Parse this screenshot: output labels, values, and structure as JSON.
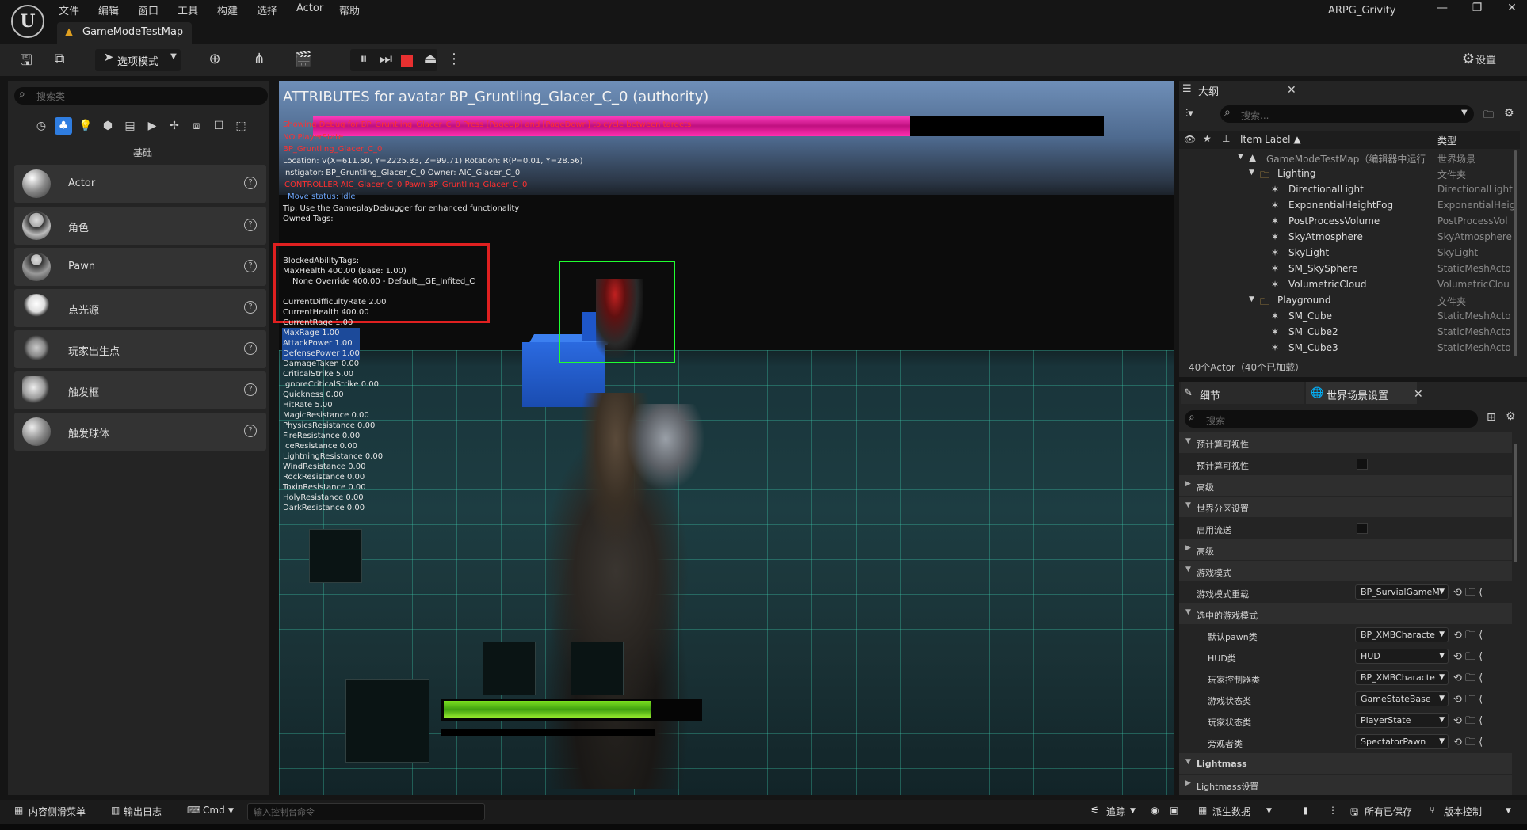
{
  "window": {
    "title": "ARPG_Grivity",
    "minimize": "—",
    "restore": "❐",
    "close": "✕"
  },
  "menu": [
    "文件",
    "编辑",
    "窗口",
    "工具",
    "构建",
    "选择",
    "Actor",
    "帮助"
  ],
  "tab": {
    "label": "GameModeTestMap"
  },
  "toolbar": {
    "mode_label": "选项模式",
    "settings_label": "设置"
  },
  "place_actors": {
    "search_placeholder": "搜索类",
    "category_label": "基础",
    "items": [
      {
        "label": "Actor"
      },
      {
        "label": "角色"
      },
      {
        "label": "Pawn"
      },
      {
        "label": "点光源"
      },
      {
        "label": "玩家出生点"
      },
      {
        "label": "触发框"
      },
      {
        "label": "触发球体"
      }
    ]
  },
  "viewport": {
    "debug_title": "ATTRIBUTES for avatar BP_Gruntling_Glacer_C_0 (authority)",
    "debug_header": "Showing Debug for BP_Gruntling_Glacer_C_0  Press [PageUp] and [PageDown] to cycle between targets",
    "red_lines": [
      "NO PlayerState",
      "BP_Gruntling_Glacer_C_0"
    ],
    "location_line": "Location: V(X=611.60, Y=2225.83, Z=99.71) Rotation: R(P=0.01, Y=28.56)",
    "instigator_line": "Instigator: BP_Gruntling_Glacer_C_0 Owner: AIC_Glacer_C_0",
    "controller_line": "CONTROLLER AIC_Glacer_C_0 Pawn BP_Gruntling_Glacer_C_0",
    "move_status": "Move status: Idle",
    "tip": "Tip: Use the GameplayDebugger for enhanced functionality",
    "owned_tags": "Owned Tags:",
    "blocked": "BlockedAbilityTags:",
    "max_health": "MaxHealth 400.00  (Base: 1.00)",
    "override": "None Override 400.00 - Default__GE_Infited_C",
    "attributes": [
      "CurrentDifficultyRate 2.00",
      "CurrentHealth 400.00",
      "CurrentRage 1.00",
      "MaxRage 1.00",
      "AttackPower 1.00",
      "DefensePower 1.00",
      "DamageTaken 0.00",
      "CriticalStrike 5.00",
      "IgnoreCriticalStrike 0.00",
      "Quickness 0.00",
      "HitRate 5.00",
      "MagicResistance 0.00",
      "PhysicsResistance 0.00",
      "FireResistance 0.00",
      "IceResistance 0.00",
      "LightningResistance 0.00",
      "WindResistance 0.00",
      "RockResistance 0.00",
      "ToxinResistance 0.00",
      "HolyResistance 0.00",
      "DarkResistance 0.00"
    ],
    "debug_bar_fraction": 0.755,
    "health_bar_fraction": 0.8
  },
  "outliner": {
    "title": "大纲",
    "search_placeholder": "搜索...",
    "col_label": "Item Label ▲",
    "col_type": "类型",
    "rows": [
      {
        "label": "GameModeTestMap（编辑器中运行",
        "type": "世界场景",
        "indent": 0
      },
      {
        "label": "Lighting",
        "type": "文件夹",
        "indent": 1
      },
      {
        "label": "DirectionalLight",
        "type": "DirectionalLight",
        "indent": 2
      },
      {
        "label": "ExponentialHeightFog",
        "type": "ExponentialHeig",
        "indent": 2
      },
      {
        "label": "PostProcessVolume",
        "type": "PostProcessVol",
        "indent": 2
      },
      {
        "label": "SkyAtmosphere",
        "type": "SkyAtmosphere",
        "indent": 2
      },
      {
        "label": "SkyLight",
        "type": "SkyLight",
        "indent": 2
      },
      {
        "label": "SM_SkySphere",
        "type": "StaticMeshActo",
        "indent": 2
      },
      {
        "label": "VolumetricCloud",
        "type": "VolumetricClou",
        "indent": 2
      },
      {
        "label": "Playground",
        "type": "文件夹",
        "indent": 1
      },
      {
        "label": "SM_Cube",
        "type": "StaticMeshActo",
        "indent": 2
      },
      {
        "label": "SM_Cube2",
        "type": "StaticMeshActo",
        "indent": 2
      },
      {
        "label": "SM_Cube3",
        "type": "StaticMeshActo",
        "indent": 2
      }
    ],
    "count": "40个Actor（40个已加载）"
  },
  "details": {
    "tab_details": "细节",
    "tab_world": "世界场景设置",
    "search_placeholder": "搜索",
    "rows": [
      {
        "kind": "section",
        "label": "预计算可视性",
        "open": true
      },
      {
        "kind": "check",
        "label": "预计算可视性"
      },
      {
        "kind": "section",
        "label": "高级",
        "open": false
      },
      {
        "kind": "section",
        "label": "世界分区设置",
        "open": true
      },
      {
        "kind": "check",
        "label": "启用流送"
      },
      {
        "kind": "section",
        "label": "高级",
        "open": false
      },
      {
        "kind": "section",
        "label": "游戏模式",
        "open": true
      },
      {
        "kind": "value",
        "label": "游戏模式重载",
        "value": "BP_SurvialGameM"
      },
      {
        "kind": "section",
        "label": "选中的游戏模式",
        "open": true
      },
      {
        "kind": "value",
        "label": "默认pawn类",
        "value": "BP_XMBCharacte"
      },
      {
        "kind": "value",
        "label": "HUD类",
        "value": "HUD"
      },
      {
        "kind": "value",
        "label": "玩家控制器类",
        "value": "BP_XMBCharacte"
      },
      {
        "kind": "value",
        "label": "游戏状态类",
        "value": "GameStateBase"
      },
      {
        "kind": "value",
        "label": "玩家状态类",
        "value": "PlayerState"
      },
      {
        "kind": "value",
        "label": "旁观者类",
        "value": "SpectatorPawn"
      },
      {
        "kind": "section",
        "label": "Lightmass",
        "open": true
      },
      {
        "kind": "section",
        "label": "Lightmass设置",
        "open": false
      }
    ]
  },
  "statusbar": {
    "content_drawer": "内容侧滑菜单",
    "output_log": "输出日志",
    "cmd": "Cmd",
    "cmd_placeholder": "输入控制台命令",
    "trace": "追踪",
    "derived_data": "派生数据",
    "all_saved": "所有已保存",
    "source_control": "版本控制"
  },
  "colors": {
    "accent": "#2f7de0",
    "debug_bar": "#e020a0",
    "health_bar": "#6cd01c",
    "highlight_box": "#e02020"
  }
}
